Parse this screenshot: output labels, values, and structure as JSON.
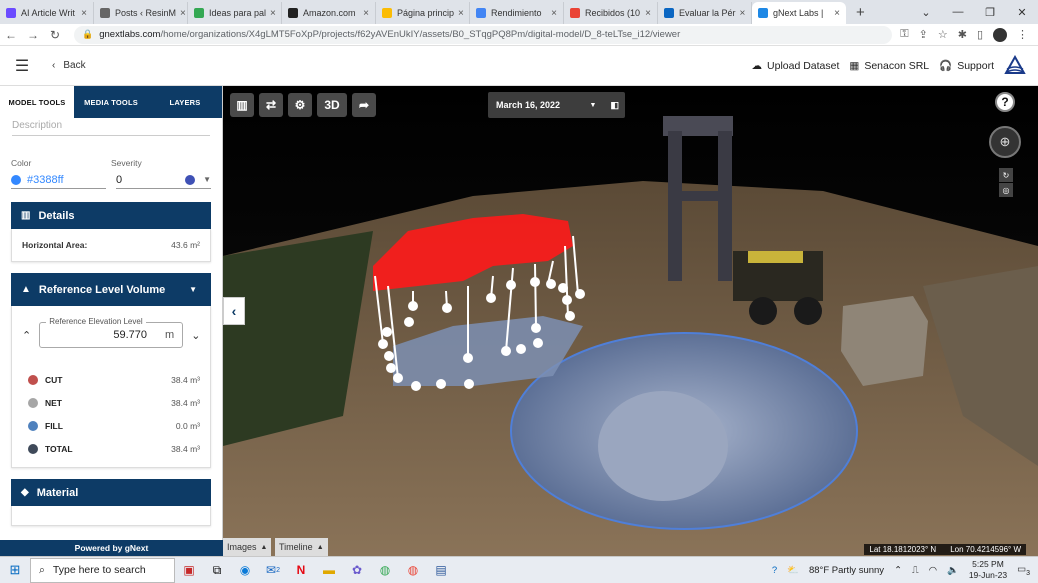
{
  "browser": {
    "tabs": [
      {
        "title": "AI Article Writ",
        "color": "#6b4bff"
      },
      {
        "title": "Posts ‹ ResinM",
        "color": "#666666"
      },
      {
        "title": "Ideas para pal",
        "color": "#34a853"
      },
      {
        "title": "Amazon.com",
        "color": "#222222"
      },
      {
        "title": "Página princip",
        "color": "#fbbc04"
      },
      {
        "title": "Rendimiento",
        "color": "#4285f4"
      },
      {
        "title": "Recibidos (10",
        "color": "#ea4335"
      },
      {
        "title": "Evaluar la Pér",
        "color": "#0a66c2"
      },
      {
        "title": "gNext Labs |",
        "color": "#1e88e5"
      }
    ],
    "url_domain": "gnextlabs.com",
    "url_path": "/home/organizations/X4gLMT5FoXpP/projects/f62yAVEnUkIY/assets/B0_STqgPQ8Pm/digital-model/D_8-teLTse_i12/viewer"
  },
  "header": {
    "back_label": "Back",
    "upload_label": "Upload Dataset",
    "org_label": "Senacon SRL",
    "support_label": "Support"
  },
  "sidebar": {
    "tabs": [
      "MODEL TOOLS",
      "MEDIA TOOLS",
      "LAYERS"
    ],
    "description_placeholder": "Description",
    "color_label": "Color",
    "color_value": "#3388ff",
    "severity_label": "Severity",
    "severity_value": "0",
    "severity_color": "#3f51b5",
    "details": {
      "title": "Details",
      "horizontal_area_label": "Horizontal Area:",
      "horizontal_area_value": "43.6 m²"
    },
    "reference": {
      "title": "Reference Level Volume",
      "elevation_label": "Reference Elevation Level",
      "elevation_value": "59.770",
      "elevation_unit": "m",
      "volumes": [
        {
          "name": "CUT",
          "value": "38.4 m³",
          "color": "#c0504d"
        },
        {
          "name": "NET",
          "value": "38.4 m³",
          "color": "#a6a6a6"
        },
        {
          "name": "FILL",
          "value": "0.0 m³",
          "color": "#4f81bd"
        },
        {
          "name": "TOTAL",
          "value": "38.4 m³",
          "color": "#3f4a5a"
        }
      ]
    },
    "material": {
      "title": "Material"
    },
    "powered_by": "Powered by gNext"
  },
  "viewport": {
    "date": "March 16, 2022",
    "tool_3d": "3D",
    "images_label": "Images",
    "timeline_label": "Timeline",
    "lat": "Lat 18.1812023° N",
    "lon": "Lon 70.4214596° W"
  },
  "taskbar": {
    "search_placeholder": "Type here to search",
    "weather": "88°F  Partly sunny",
    "time": "5:25 PM",
    "date": "19-Jun-23",
    "mail_badge": "2",
    "notif_badge": "3"
  }
}
